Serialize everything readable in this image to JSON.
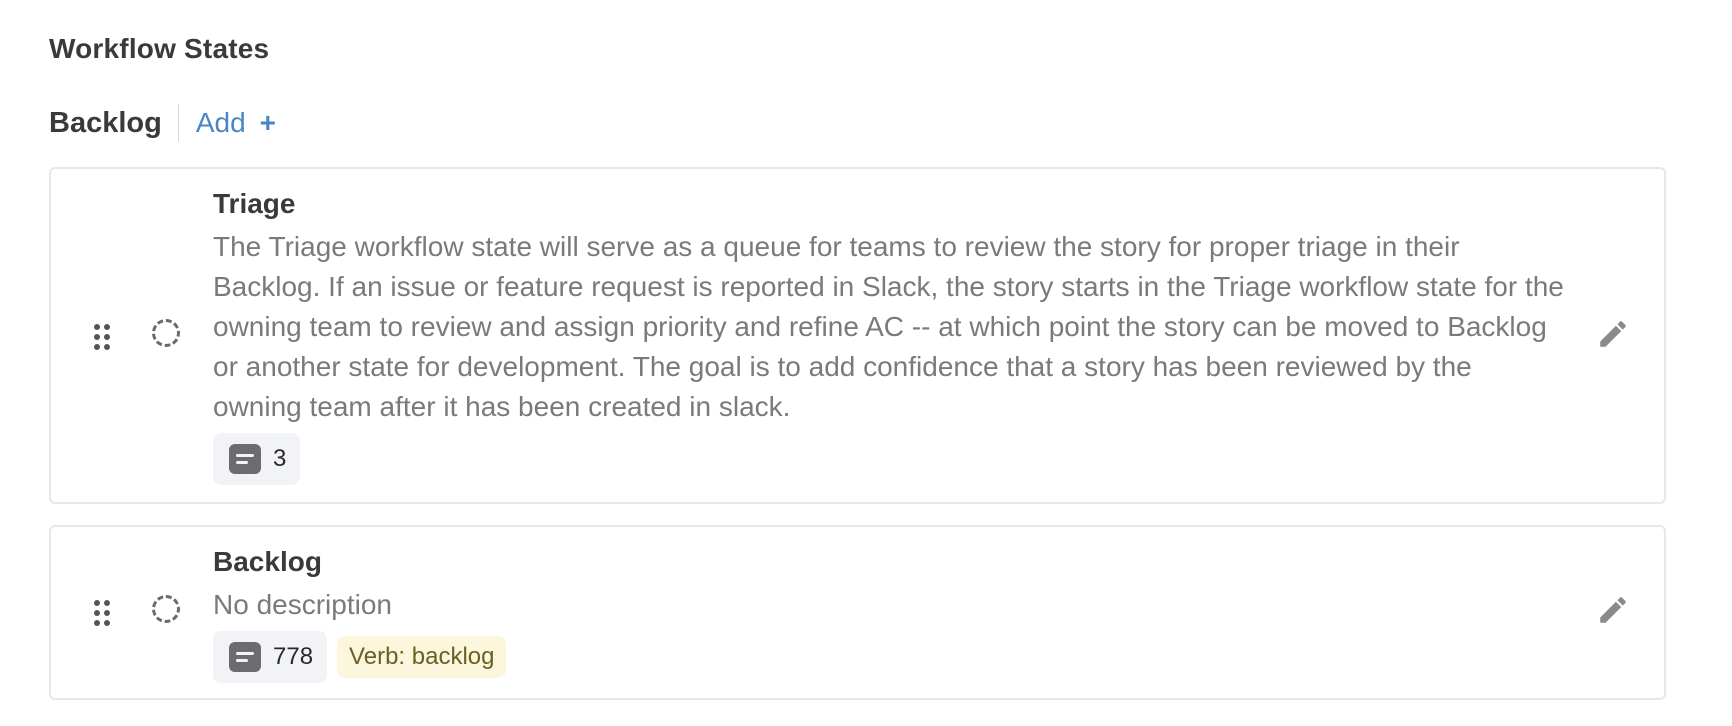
{
  "section": {
    "title": "Workflow States"
  },
  "group": {
    "name": "Backlog",
    "add_label": "Add",
    "add_icon": "plus-icon"
  },
  "states": [
    {
      "title": "Triage",
      "description": "The Triage workflow state will serve as a queue for teams to review the story for proper triage in their Backlog. If an issue or feature request is reported in Slack, the story starts in the Triage workflow state for the owning team to review and assign priority and refine AC -- at which point the story can be moved to Backlog or another state for development. The goal is to add confidence that a story has been reviewed by the owning team after it has been created in slack.",
      "story_count": "3",
      "verb": null
    },
    {
      "title": "Backlog",
      "description": "No description",
      "story_count": "778",
      "verb": "Verb: backlog"
    }
  ],
  "icons": {
    "drag": "drag-handle-icon",
    "status": "backlog-state-icon",
    "story": "story-icon",
    "edit": "pencil-icon"
  },
  "colors": {
    "accent": "#4a86c5",
    "verb_bg": "#fcf7dc",
    "chip_bg": "#f2f3f6"
  }
}
